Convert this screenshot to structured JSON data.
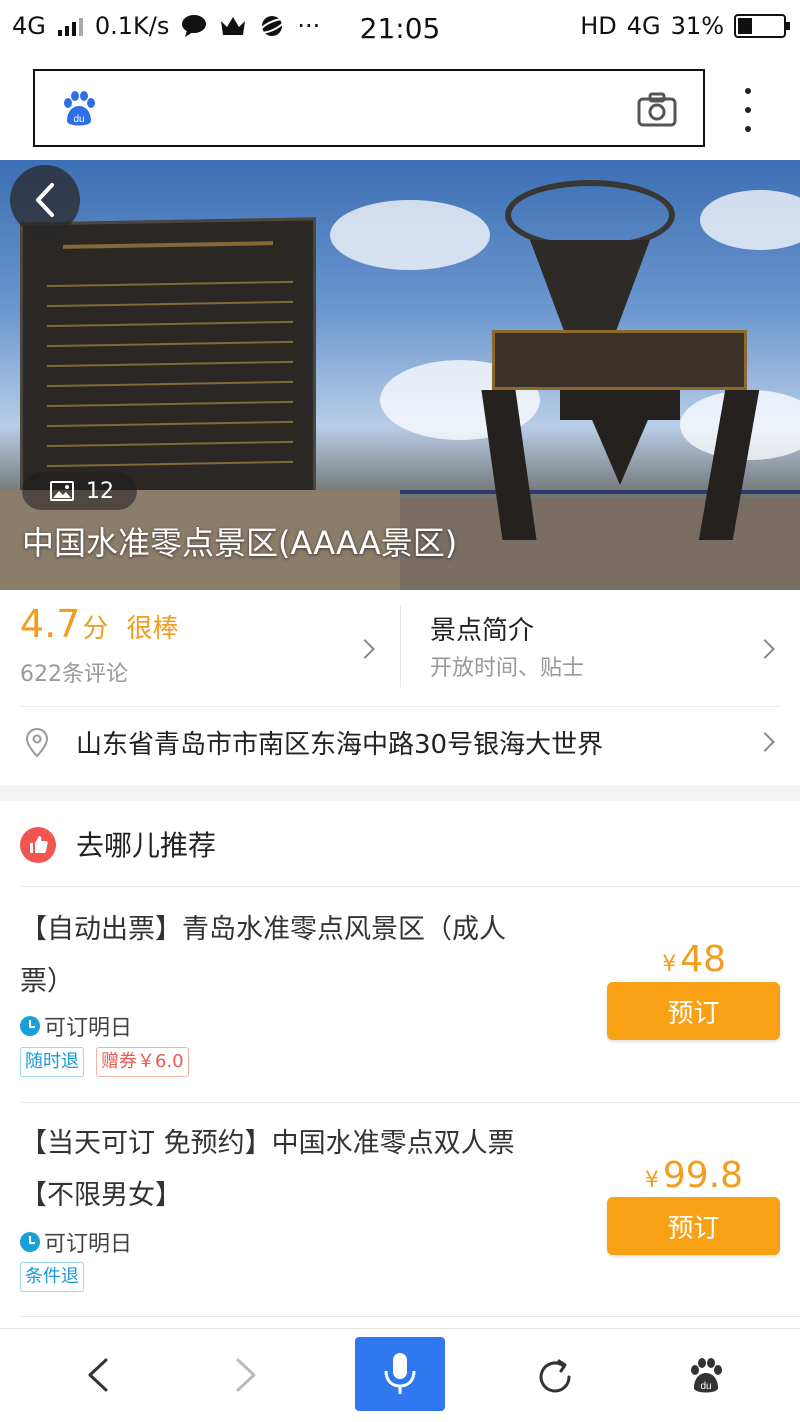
{
  "status_bar": {
    "network": "4G",
    "speed": "0.1K/s",
    "time": "21:05",
    "hd": "HD",
    "network_right": "4G",
    "battery": "31%",
    "battery_level": 0.31
  },
  "search": {
    "logo_icon": "baidu-paw-icon",
    "camera_icon": "camera-icon",
    "more_icon": "more-vertical-icon"
  },
  "hero": {
    "photo_count": "12",
    "title": "中国水准零点景区(AAAA景区)"
  },
  "rating": {
    "score": "4.7",
    "unit": "分",
    "word": "很棒",
    "reviews": "622条评论"
  },
  "intro": {
    "title": "景点简介",
    "subtitle": "开放时间、贴士"
  },
  "address": "山东省青岛市市南区东海中路30号银海大世界",
  "recommend": {
    "title": "去哪儿推荐"
  },
  "products": [
    {
      "name_line1": "【自动出票】青岛水准零点风景区（成人",
      "name_line2": "票）",
      "availability": "可订明日",
      "tag1": "随时退",
      "tag2": "赠券￥6.0",
      "currency": "¥",
      "price": "48",
      "button": "预订"
    },
    {
      "name_line1": "【当天可订 免预约】中国水准零点双人票",
      "name_line2": "【不限男女】",
      "availability": "可订明日",
      "tag1": "条件退",
      "currency": "¥",
      "price": "99.8",
      "button": "预订"
    }
  ],
  "colors": {
    "accent_orange": "#f8a114",
    "price_orange": "#f39c1e",
    "blue": "#2f78f0",
    "red_icon": "#f0564f"
  }
}
